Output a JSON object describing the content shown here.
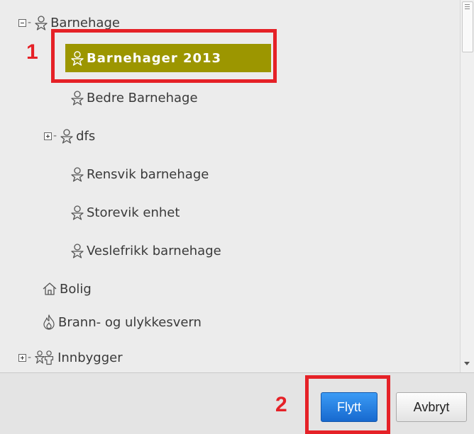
{
  "tree": {
    "root": {
      "label": "Barnehage",
      "expanded": true
    },
    "children": [
      {
        "label": "Barnehager 2013",
        "selected": true
      },
      {
        "label": "Bedre Barnehage"
      },
      {
        "label": "dfs",
        "expandable": true
      },
      {
        "label": "Rensvik barnehage"
      },
      {
        "label": "Storevik enhet"
      },
      {
        "label": "Veslefrikk barnehage"
      }
    ],
    "siblings": [
      {
        "label": "Bolig",
        "icon": "house-icon"
      },
      {
        "label": "Brann- og ulykkesvern",
        "icon": "flame-icon"
      },
      {
        "label": "Innbygger",
        "icon": "people-icon",
        "expandable": true
      }
    ]
  },
  "annotations": {
    "step1": "1",
    "step2": "2",
    "color": "#e52127"
  },
  "footer": {
    "move_label": "Flytt",
    "cancel_label": "Avbryt"
  },
  "colors": {
    "selected_bg": "#9c9600",
    "primary_button": "#1f7ae0"
  }
}
